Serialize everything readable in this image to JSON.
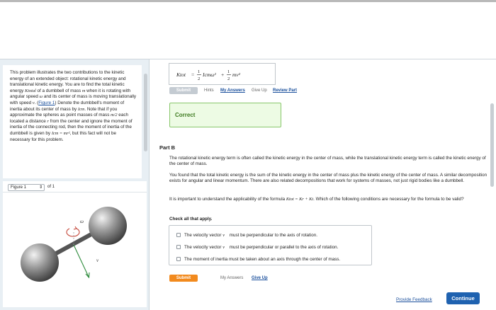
{
  "intro": {
    "p1": "This problem illustrates the two contributions to the kinetic energy of an extended object: rotational kinetic energy and translational kinetic energy. You are to find the total kinetic energy ",
    "ktotal": "Ktotal",
    "p2": " of a dumbbell of mass ",
    "m": "m",
    "p3": " when it is rotating with angular speed ",
    "omega": "ω",
    "p4": " and its center of mass is moving translationally with speed ",
    "v": "v",
    "p5": ". (",
    "figure_link": "Figure 1",
    "p6": ") Denote the dumbbell's moment of inertia about its center of mass by ",
    "icm": "Icm",
    "p7": ". Note that if you approximate the spheres as point masses of mass ",
    "m2": "m/2",
    "p8": " each located a distance ",
    "r": "r",
    "p9": " from the center and ignore the moment of inertia of the connecting rod, then the moment of inertia of the dumbbell is given by ",
    "icm_eq": "Icm = mr²",
    "p10": ", but this fact will not be necessary for this problem."
  },
  "figure": {
    "select_label": "Figure 1",
    "of_label": "of 1",
    "omega_label": "ω",
    "v_label": "v"
  },
  "answer_box": {
    "formula_lhs": "Ktot",
    "formula_rhs_1": "Icmω²",
    "formula_rhs_2": "mv²"
  },
  "top_actions": {
    "submit": "Submit",
    "hints": "Hints",
    "my_answers": "My Answers",
    "give_up": "Give Up",
    "review_part": "Review Part"
  },
  "correct_label": "Correct",
  "part_b": {
    "title": "Part B",
    "para1": "The rotational kinetic energy term is often called the kinetic energy in the center of mass, while the translational kinetic energy term is called the kinetic energy of the center of mass.",
    "para2": "You found that the total kinetic energy is the sum of the kinetic energy in the center of mass plus the kinetic energy of the center of mass. A similar decomposition exists for angular and linear momentum. There are also related decompositions that work for systems of masses, not just rigid bodies like a dumbbell.",
    "para3a": "It is important to understand the applicability of the formula ",
    "para3_formula": "Ktot = Kr + Kt",
    "para3b": ". Which of the following conditions are necessary for the formula to be valid?",
    "check_all": "Check all that apply.",
    "options": [
      {
        "a": "The velocity vector ",
        "sym": "v⃗",
        "b": " must be perpendicular to the axis of rotation."
      },
      {
        "a": "The velocity vector ",
        "sym": "v⃗",
        "b": " must be perpendicular or parallel to the axis of rotation."
      },
      {
        "a": "The moment of inertia must be taken about an axis through the center of mass.",
        "sym": "",
        "b": ""
      }
    ],
    "submit": "Submit",
    "my_answers": "My Answers",
    "give_up": "Give Up"
  },
  "footer": {
    "feedback": "Provide Feedback",
    "continue": "Continue"
  },
  "colors": {
    "accent": "#1f62b0",
    "submit_orange": "#f28a1e",
    "correct_green": "#87c66a",
    "left_bg": "#e8eff4"
  }
}
